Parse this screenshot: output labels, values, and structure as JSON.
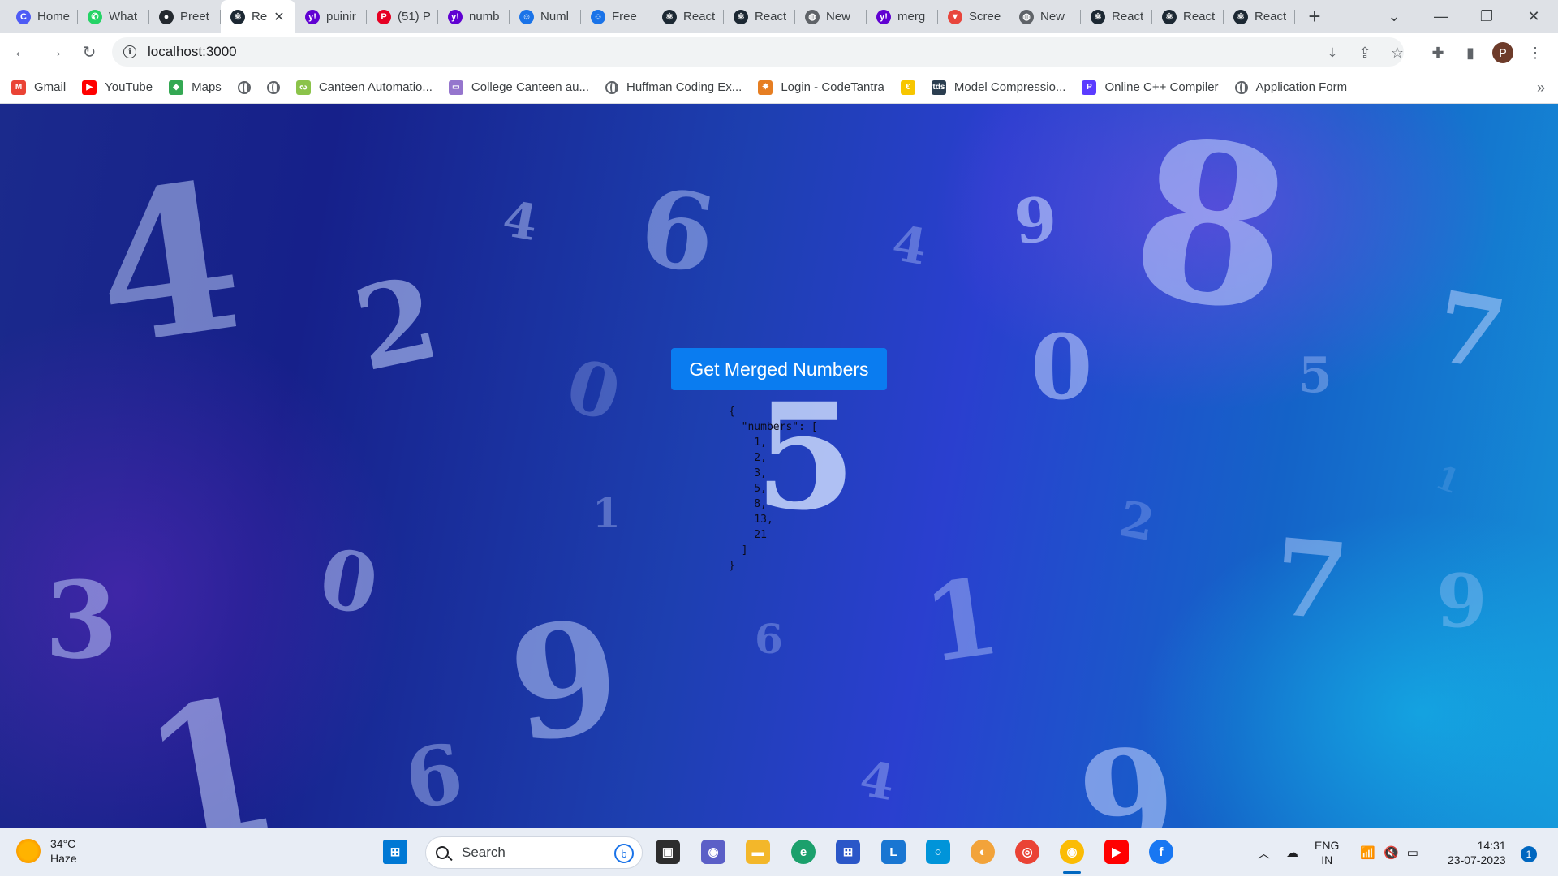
{
  "browser": {
    "tabs": [
      {
        "label": "Home",
        "icon": "c-logo-icon",
        "color": "#4e5bf5",
        "glyph": "C"
      },
      {
        "label": "What",
        "icon": "whatsapp-icon",
        "color": "#25d366",
        "glyph": "✆"
      },
      {
        "label": "Preet",
        "icon": "github-icon",
        "color": "#24292f",
        "glyph": "●"
      },
      {
        "label": "Re",
        "icon": "react-icon",
        "color": "#1c2833",
        "glyph": "⚛",
        "active": true
      },
      {
        "label": "puinir",
        "icon": "yahoo-icon",
        "color": "#6001d2",
        "glyph": "y!"
      },
      {
        "label": "(51) P",
        "icon": "pinterest-icon",
        "color": "#e60023",
        "glyph": "P"
      },
      {
        "label": "numb",
        "icon": "yahoo-icon",
        "color": "#6001d2",
        "glyph": "y!"
      },
      {
        "label": "Numl",
        "icon": "bot-icon",
        "color": "#1a73e8",
        "glyph": "☺"
      },
      {
        "label": "Free",
        "icon": "bot-icon",
        "color": "#1a73e8",
        "glyph": "☺"
      },
      {
        "label": "React",
        "icon": "react-icon",
        "color": "#1c2833",
        "glyph": "⚛"
      },
      {
        "label": "React",
        "icon": "react-icon",
        "color": "#1c2833",
        "glyph": "⚛"
      },
      {
        "label": "New",
        "icon": "globe-icon",
        "color": "#5f6368",
        "glyph": "◍"
      },
      {
        "label": "merg",
        "icon": "yahoo-icon",
        "color": "#6001d2",
        "glyph": "y!"
      },
      {
        "label": "Scree",
        "icon": "screenshot-icon",
        "color": "#e8453c",
        "glyph": "▼"
      },
      {
        "label": "New",
        "icon": "globe-icon",
        "color": "#5f6368",
        "glyph": "◍"
      },
      {
        "label": "React",
        "icon": "react-icon",
        "color": "#1c2833",
        "glyph": "⚛"
      },
      {
        "label": "React",
        "icon": "react-icon",
        "color": "#1c2833",
        "glyph": "⚛"
      },
      {
        "label": "React",
        "icon": "react-icon",
        "color": "#1c2833",
        "glyph": "⚛"
      }
    ],
    "new_tab": "+",
    "url": "localhost:3000",
    "avatar": "P",
    "bookmarks": [
      {
        "label": "Gmail",
        "icon": "gmail-icon",
        "color": "#ea4335",
        "glyph": "M"
      },
      {
        "label": "YouTube",
        "icon": "youtube-icon",
        "color": "#ff0000",
        "glyph": "▶"
      },
      {
        "label": "Maps",
        "icon": "maps-icon",
        "color": "#34a853",
        "glyph": "◆"
      },
      {
        "label": "",
        "icon": "globe-icon",
        "color": "",
        "glyph": ""
      },
      {
        "label": "",
        "icon": "globe-icon",
        "color": "",
        "glyph": ""
      },
      {
        "label": "Canteen Automatio...",
        "icon": "canteen-icon",
        "color": "#8bc34a",
        "glyph": "ᔓ"
      },
      {
        "label": "College Canteen au...",
        "icon": "college-icon",
        "color": "#9575cd",
        "glyph": "▭"
      },
      {
        "label": "Huffman Coding Ex...",
        "icon": "globe-icon",
        "color": "",
        "glyph": ""
      },
      {
        "label": "Login - CodeTantra",
        "icon": "codetantra-icon",
        "color": "#e67e22",
        "glyph": "✸"
      },
      {
        "label": "",
        "icon": "coin-icon",
        "color": "#f7c600",
        "glyph": "€"
      },
      {
        "label": "Model Compressio...",
        "icon": "tds-icon",
        "color": "#2b3e50",
        "glyph": "tds"
      },
      {
        "label": "Online C++ Compiler",
        "icon": "compiler-icon",
        "color": "#5b3cff",
        "glyph": "P"
      },
      {
        "label": "Application Form",
        "icon": "globe-icon",
        "color": "",
        "glyph": ""
      }
    ]
  },
  "page": {
    "button_label": "Get Merged Numbers",
    "result_json": "{\n  \"numbers\": [\n    1,\n    2,\n    3,\n    5,\n    8,\n    13,\n    21\n  ]\n}",
    "numbers": [
      1,
      2,
      3,
      5,
      8,
      13,
      21
    ]
  },
  "taskbar": {
    "weather_temp": "34°C",
    "weather_desc": "Haze",
    "search_placeholder": "Search",
    "lang_line1": "ENG",
    "lang_line2": "IN",
    "time": "14:31",
    "date": "23-07-2023",
    "notification_count": "1"
  }
}
